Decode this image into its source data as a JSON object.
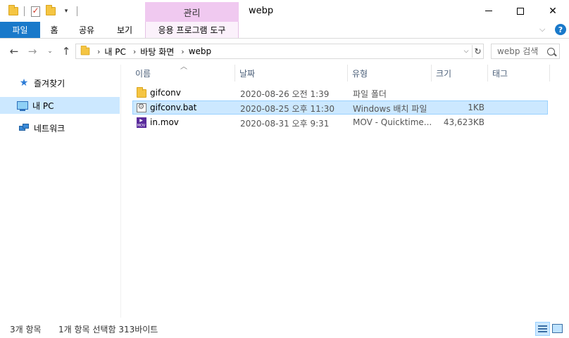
{
  "titlebar": {
    "window_title": "webp",
    "manage_tab": "관리",
    "qat_dropdown_glyph": "▾"
  },
  "ribbon": {
    "tabs": [
      "파일",
      "홈",
      "공유",
      "보기",
      "응용 프로그램 도구"
    ],
    "accent": "#1979ca",
    "contextual_color": "#f0c9f0"
  },
  "address": {
    "breadcrumbs": [
      "내 PC",
      "바탕 화면",
      "webp"
    ],
    "search_placeholder": "webp 검색"
  },
  "navpane": {
    "items": [
      "즐겨찾기",
      "내 PC",
      "네트워크"
    ],
    "selected": "내 PC"
  },
  "filelist": {
    "columns": [
      "이름",
      "날짜",
      "유형",
      "크기",
      "태그"
    ],
    "rows": [
      {
        "name": "gifconv",
        "date": "2020-08-26 오전 1:39",
        "type": "파일 폴더",
        "size": "",
        "icon": "folder-icon"
      },
      {
        "name": "gifconv.bat",
        "date": "2020-08-25 오후 11:30",
        "type": "Windows 배치 파일",
        "size": "1KB",
        "icon": "batch-file-icon",
        "selected": true
      },
      {
        "name": "in.mov",
        "date": "2020-08-31 오후 9:31",
        "type": "MOV - Quicktime...",
        "size": "43,623KB",
        "icon": "mov-file-icon"
      }
    ],
    "mov_icon_text": "MOV"
  },
  "status": {
    "item_count": "3개 항목",
    "selection": "1개 항목 선택함 313바이트"
  }
}
